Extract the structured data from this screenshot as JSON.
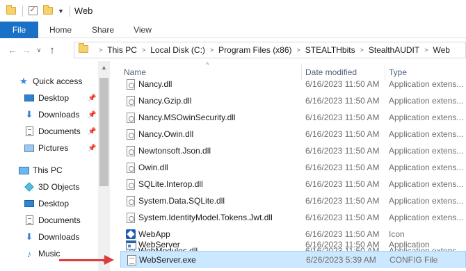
{
  "window": {
    "title": "Web"
  },
  "quick_access_toolbar": {
    "icons": [
      "folder-icon",
      "properties-icon",
      "new-folder-icon",
      "customize-dropdown-icon"
    ]
  },
  "ribbon": {
    "tabs": [
      {
        "label": "File",
        "active": true
      },
      {
        "label": "Home"
      },
      {
        "label": "Share"
      },
      {
        "label": "View"
      }
    ]
  },
  "address": {
    "breadcrumbs": [
      "This PC",
      "Local Disk (C:)",
      "Program Files (x86)",
      "STEALTHbits",
      "StealthAUDIT",
      "Web"
    ]
  },
  "navigation": {
    "items": [
      {
        "label": "Quick access",
        "icon": "star-icon",
        "pinned": false
      },
      {
        "label": "Desktop",
        "icon": "desktop-icon",
        "pinned": true
      },
      {
        "label": "Downloads",
        "icon": "download-icon",
        "pinned": true
      },
      {
        "label": "Documents",
        "icon": "documents-icon",
        "pinned": true
      },
      {
        "label": "Pictures",
        "icon": "pictures-icon",
        "pinned": true
      },
      {
        "label": "This PC",
        "icon": "computer-icon",
        "pinned": false
      },
      {
        "label": "3D Objects",
        "icon": "3d-objects-icon",
        "pinned": false
      },
      {
        "label": "Desktop",
        "icon": "desktop-icon",
        "pinned": false
      },
      {
        "label": "Documents",
        "icon": "documents-icon",
        "pinned": false
      },
      {
        "label": "Downloads",
        "icon": "download-icon",
        "pinned": false
      },
      {
        "label": "Music",
        "icon": "music-icon",
        "pinned": false
      }
    ]
  },
  "columns": {
    "name": "Name",
    "date": "Date modified",
    "type": "Type"
  },
  "files": [
    {
      "name": "Nancy.dll",
      "date": "6/16/2023 11:50 AM",
      "type": "Application extens...",
      "icon": "dll-file-icon"
    },
    {
      "name": "Nancy.Gzip.dll",
      "date": "6/16/2023 11:50 AM",
      "type": "Application extens...",
      "icon": "dll-file-icon"
    },
    {
      "name": "Nancy.MSOwinSecurity.dll",
      "date": "6/16/2023 11:50 AM",
      "type": "Application extens...",
      "icon": "dll-file-icon"
    },
    {
      "name": "Nancy.Owin.dll",
      "date": "6/16/2023 11:50 AM",
      "type": "Application extens...",
      "icon": "dll-file-icon"
    },
    {
      "name": "Newtonsoft.Json.dll",
      "date": "6/16/2023 11:50 AM",
      "type": "Application extens...",
      "icon": "dll-file-icon"
    },
    {
      "name": "Owin.dll",
      "date": "6/16/2023 11:50 AM",
      "type": "Application extens...",
      "icon": "dll-file-icon"
    },
    {
      "name": "SQLite.Interop.dll",
      "date": "6/16/2023 11:50 AM",
      "type": "Application extens...",
      "icon": "dll-file-icon"
    },
    {
      "name": "System.Data.SQLite.dll",
      "date": "6/16/2023 11:50 AM",
      "type": "Application extens...",
      "icon": "dll-file-icon"
    },
    {
      "name": "System.IdentityModel.Tokens.Jwt.dll",
      "date": "6/16/2023 11:50 AM",
      "type": "Application extens...",
      "icon": "dll-file-icon"
    },
    {
      "name": "WebApp",
      "date": "6/16/2023 11:50 AM",
      "type": "Icon",
      "icon": "app-icon-file-icon"
    },
    {
      "name": "WebModules.dll",
      "date": "6/16/2023 11:50 AM",
      "type": "Application extens...",
      "icon": "dll-file-icon"
    },
    {
      "name": "WebServer",
      "date": "6/16/2023 11:50 AM",
      "type": "Application",
      "icon": "exe-file-icon"
    },
    {
      "name": "WebServer.exe",
      "date": "6/26/2023 5:39 AM",
      "type": "CONFIG File",
      "icon": "config-file-icon",
      "selected": true
    }
  ],
  "annotation": {
    "color": "#e03a3a",
    "points_to": "WebServer.exe"
  },
  "colors": {
    "accent": "#1a6fc7",
    "selection": "#cce8ff",
    "selection_border": "#99d1ff"
  }
}
